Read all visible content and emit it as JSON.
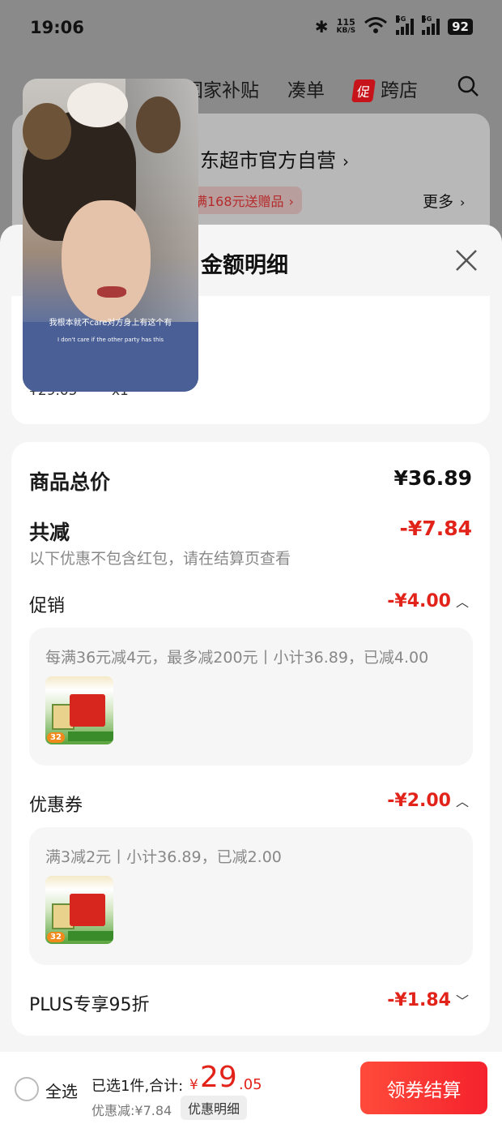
{
  "status_bar": {
    "time": "19:06",
    "net_speed_value": "115",
    "net_speed_unit": "KB/S",
    "signal1_label": "5G",
    "signal2_label": "5G",
    "battery": "92"
  },
  "top_nav": {
    "item1": "国家补贴",
    "item2": "凑单",
    "promo_badge": "促",
    "item3": "跨店"
  },
  "background_store": {
    "name": "东超市官方自营",
    "name_chevron": "›",
    "promo": "满168元送赠品",
    "promo_chevron": "›",
    "more": "更多",
    "more_chevron": "›"
  },
  "sheet": {
    "title": "金额明细",
    "item": {
      "price": "¥29.05",
      "qty": "x1"
    },
    "total": {
      "label": "商品总价",
      "value": "¥36.89"
    },
    "reduction": {
      "label": "共减",
      "value": "-¥7.84",
      "note": "以下优惠不包含红包，请在结算页查看"
    },
    "promotion": {
      "label": "促销",
      "value": "-¥4.00",
      "chevron": "︿",
      "detail": "每满36元减4元，最多减200元丨小计36.89，已减4.00"
    },
    "coupon": {
      "label": "优惠券",
      "value": "-¥2.00",
      "chevron": "︿",
      "detail": "满3减2元丨小计36.89，已减2.00"
    },
    "plus": {
      "label": "PLUS专享95折",
      "value": "-¥1.84",
      "chevron": "﹀"
    },
    "thumb": {
      "tag": "32"
    }
  },
  "bottom_bar": {
    "select_all": "全选",
    "selected_text": "已选1件,合计:",
    "currency": "¥",
    "amount_int": "29",
    "amount_dec": ".05",
    "discount": "优惠减:¥7.84",
    "detail_button": "优惠明细",
    "checkout": "领券结算"
  },
  "video": {
    "subtitle_cn": "我根本就不care对方身上有这个有",
    "subtitle_en": "I don't care if the other party has this"
  },
  "colors": {
    "accent": "#e2231a",
    "checkout_bg": "#f5222d"
  }
}
